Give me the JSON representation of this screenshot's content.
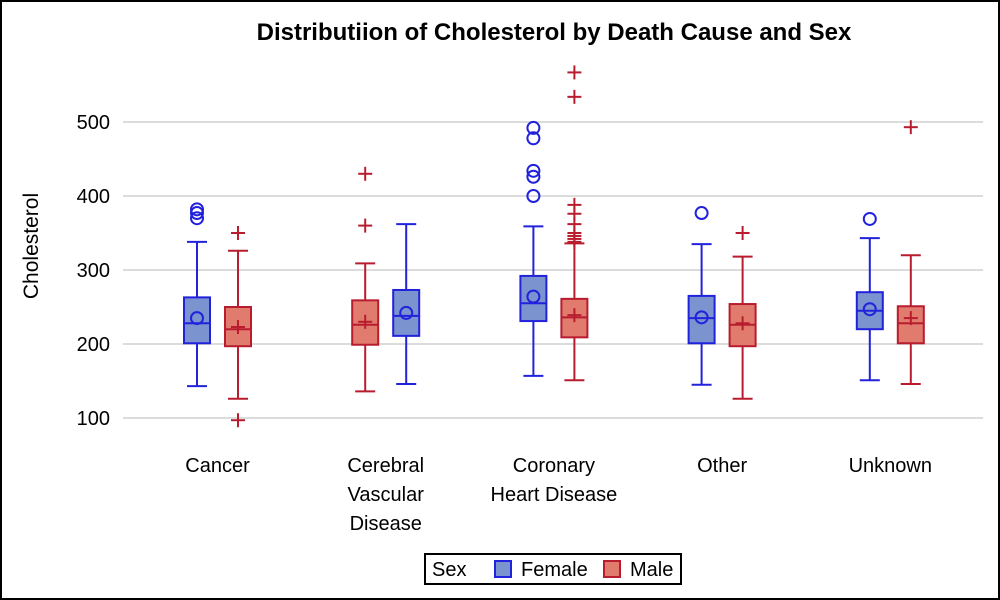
{
  "chart_data": {
    "type": "box",
    "title": "Distributiion of Cholesterol by Death Cause and Sex",
    "xlabel": "",
    "ylabel": "Cholesterol",
    "ylim": [
      50,
      580
    ],
    "yticks": [
      100,
      200,
      300,
      400,
      500
    ],
    "grid": true,
    "categories": [
      [
        "Cancer"
      ],
      [
        "Cerebral",
        "Vascular",
        "Disease"
      ],
      [
        "Coronary",
        "Heart Disease"
      ],
      [
        "Other"
      ],
      [
        "Unknown"
      ]
    ],
    "category_names": [
      "Cancer",
      "Cerebral Vascular Disease",
      "Coronary Heart Disease",
      "Other",
      "Unknown"
    ],
    "legend": {
      "title": "Sex",
      "placement": "bottom",
      "entries": [
        "Female",
        "Male"
      ]
    },
    "series": [
      {
        "name": "Female",
        "color": "#2222dd",
        "fill": "#7b93cf",
        "mean_marker": "circle",
        "boxes": [
          {
            "category": "Cancer",
            "min": 143,
            "q1": 201,
            "median": 228,
            "q3": 263,
            "max": 338,
            "mean": 235,
            "outliers": [
              370,
              377,
              382
            ]
          },
          {
            "category": "Cerebral Vascular Disease",
            "min": 146,
            "q1": 211,
            "median": 238,
            "q3": 273,
            "max": 362,
            "mean": 242,
            "outliers": []
          },
          {
            "category": "Coronary Heart Disease",
            "min": 157,
            "q1": 231,
            "median": 255,
            "q3": 292,
            "max": 359,
            "mean": 264,
            "outliers": [
              400,
              426,
              434,
              478,
              492
            ]
          },
          {
            "category": "Other",
            "min": 145,
            "q1": 201,
            "median": 235,
            "q3": 265,
            "max": 335,
            "mean": 236,
            "outliers": [
              377
            ]
          },
          {
            "category": "Unknown",
            "min": 151,
            "q1": 220,
            "median": 245,
            "q3": 270,
            "max": 343,
            "mean": 247,
            "outliers": [
              369
            ]
          }
        ]
      },
      {
        "name": "Male",
        "color": "#b81c2e",
        "fill": "#e07b6e",
        "mean_marker": "plus",
        "boxes": [
          {
            "category": "Cancer",
            "min": 126,
            "q1": 197,
            "median": 220,
            "q3": 250,
            "max": 326,
            "mean": 223,
            "outliers": [
              97,
              350
            ]
          },
          {
            "category": "Cerebral Vascular Disease",
            "min": 136,
            "q1": 199,
            "median": 226,
            "q3": 259,
            "max": 309,
            "mean": 230,
            "outliers": [
              360,
              430
            ]
          },
          {
            "category": "Coronary Heart Disease",
            "min": 151,
            "q1": 209,
            "median": 236,
            "q3": 261,
            "max": 336,
            "mean": 239,
            "outliers": [
              338,
              342,
              346,
              350,
              362,
              376,
              388,
              534,
              567
            ]
          },
          {
            "category": "Other",
            "min": 126,
            "q1": 197,
            "median": 226,
            "q3": 254,
            "max": 318,
            "mean": 228,
            "outliers": [
              350
            ]
          },
          {
            "category": "Unknown",
            "min": 146,
            "q1": 201,
            "median": 228,
            "q3": 251,
            "max": 320,
            "mean": 235,
            "outliers": [
              493
            ]
          }
        ]
      }
    ]
  }
}
